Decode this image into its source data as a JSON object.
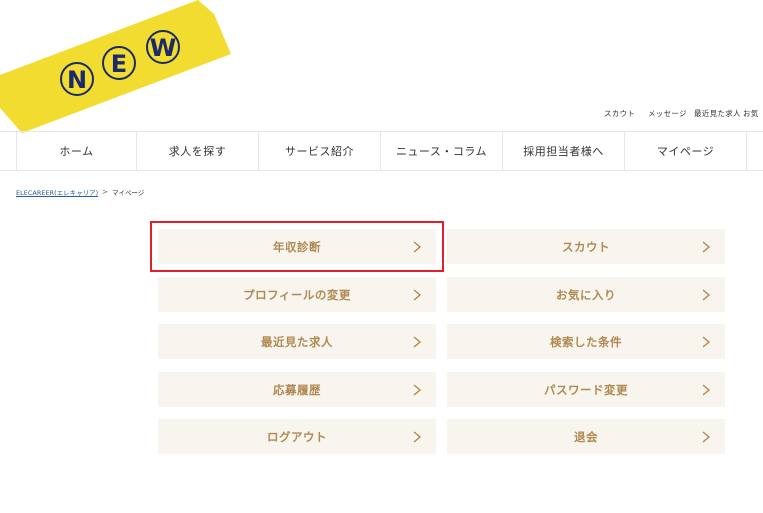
{
  "badge": {
    "letters": [
      "N",
      "E",
      "W"
    ],
    "ribbon_color": "#f2dc2f",
    "ink_color": "#1b2a6b"
  },
  "top_links": [
    "スカウト",
    "メッセージ",
    "最近見た求人",
    "お気"
  ],
  "nav": [
    "ホーム",
    "求人を探す",
    "サービス紹介",
    "ニュース・コラム",
    "採用担当者様へ",
    "マイページ"
  ],
  "breadcrumb": {
    "home": "ELECAREER(エレキャリア)",
    "separator": ">",
    "current": "マイページ"
  },
  "menu": {
    "left": [
      "年収診断",
      "プロフィールの変更",
      "最近見た求人",
      "応募履歴",
      "ログアウト"
    ],
    "right": [
      "スカウト",
      "お気に入り",
      "検索した条件",
      "パスワード変更",
      "退会"
    ]
  },
  "colors": {
    "button_bg": "#f8f4ee",
    "button_text": "#b08a52",
    "highlight": "#e0202a"
  }
}
